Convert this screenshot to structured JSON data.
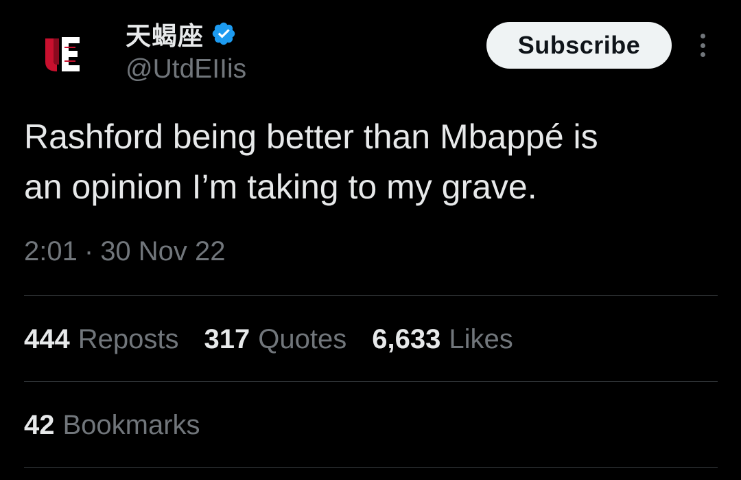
{
  "author": {
    "display_name": "天蝎座",
    "handle": "@UtdEIIis",
    "verified": true,
    "verified_color": "#1d9bf0",
    "avatar_logo_color": "#c8102e"
  },
  "actions": {
    "subscribe_label": "Subscribe"
  },
  "tweet": {
    "text": "Rashford being better than Mbappé is\nan opinion I’m taking to my grave.",
    "time": "2:01",
    "separator": "·",
    "date": "30 Nov 22"
  },
  "stats": {
    "reposts": {
      "count": "444",
      "label": "Reposts"
    },
    "quotes": {
      "count": "317",
      "label": "Quotes"
    },
    "likes": {
      "count": "6,633",
      "label": "Likes"
    },
    "bookmarks": {
      "count": "42",
      "label": "Bookmarks"
    }
  },
  "colors": {
    "background": "#000000",
    "primary_text": "#e7e9ea",
    "secondary_text": "#71767b",
    "divider": "#2f3336",
    "button_bg": "#eff3f4"
  }
}
